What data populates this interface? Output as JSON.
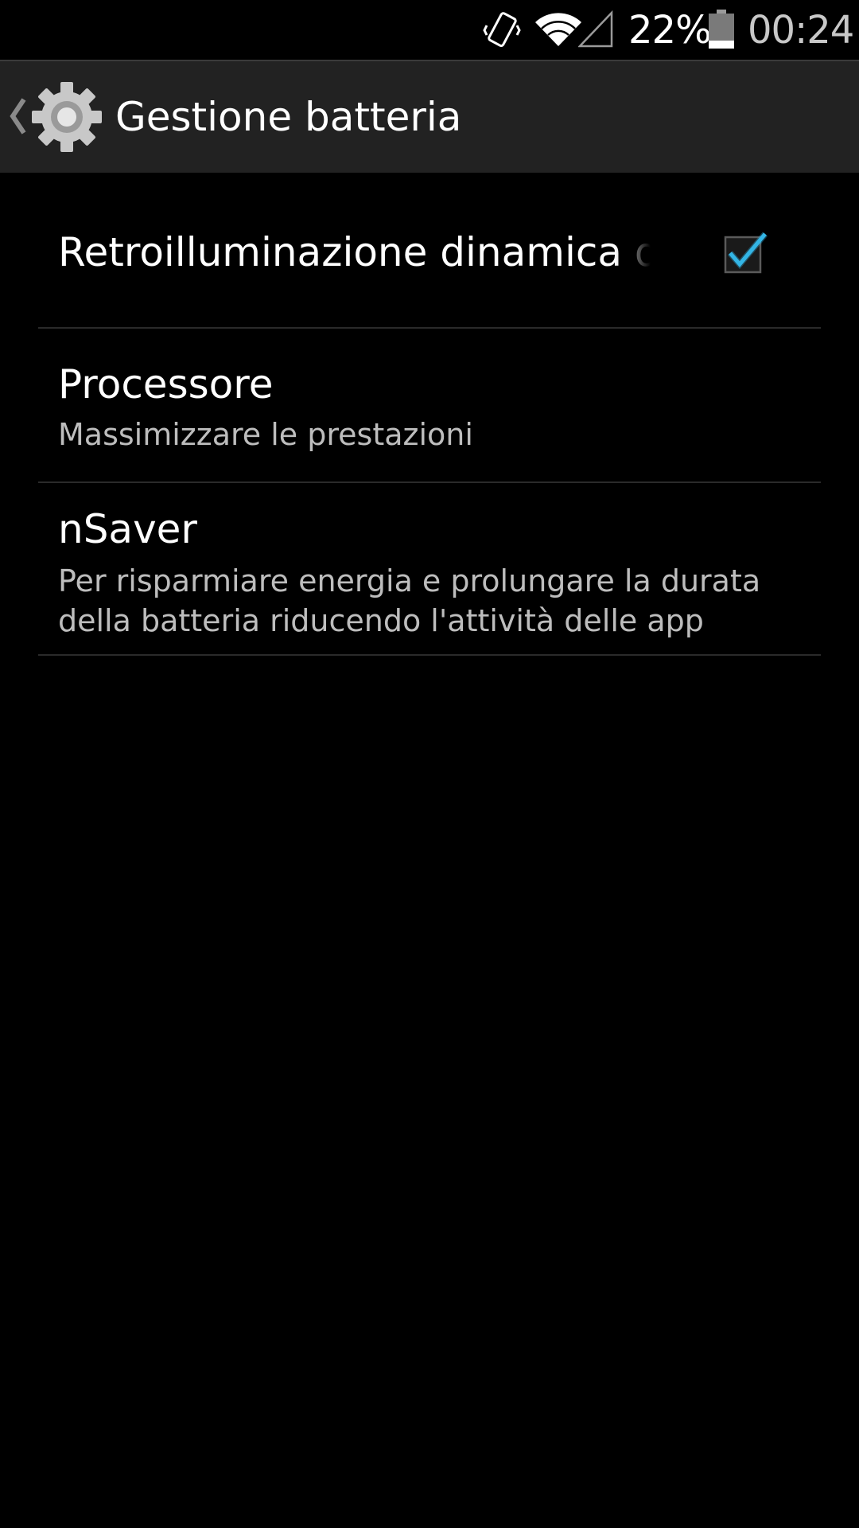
{
  "status_bar": {
    "battery_percent": "22%",
    "time": "00:24",
    "icons": [
      "vibrate-icon",
      "wifi-icon",
      "signal-icon",
      "battery-icon"
    ],
    "battery_level": 0.22
  },
  "action_bar": {
    "title": "Gestione batteria",
    "icons": [
      "back-chevron-icon",
      "gear-icon"
    ]
  },
  "preferences": [
    {
      "title": "Retroilluminazione dinamica di",
      "checked": true
    },
    {
      "title": "Processore",
      "summary": "Massimizzare le prestazioni"
    },
    {
      "title": "nSaver",
      "summary": "Per risparmiare energia e prolungare la durata della batteria riducendo l'attività delle app"
    }
  ],
  "colors": {
    "background": "#000000",
    "action_bar": "#222222",
    "accent": "#33b5e5",
    "divider": "#2a2a2a",
    "summary_text": "#bdbdbd"
  }
}
